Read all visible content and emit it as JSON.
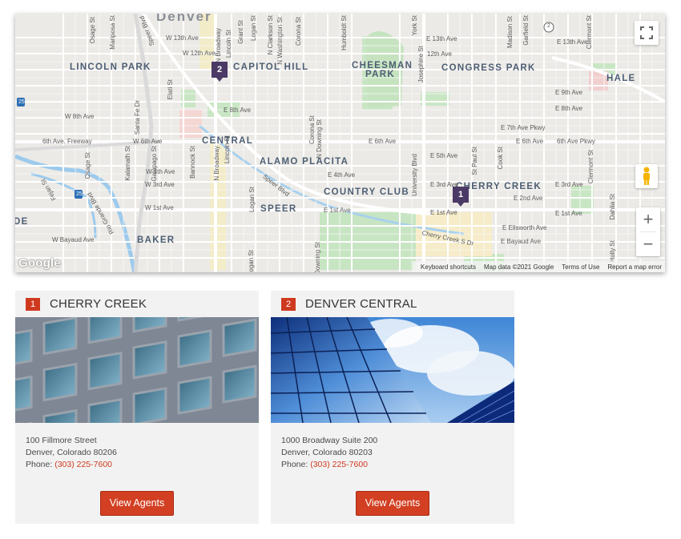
{
  "map": {
    "neighborhoods": [
      "Denver",
      "LINCOLN PARK",
      "CAPITOL HILL",
      "CHEESMAN",
      "PARK",
      "CONGRESS PARK",
      "HALE",
      "CENTRAL",
      "ALAMO PLACITA",
      "COUNTRY CLUB",
      "CHERRY CREEK",
      "SPEER",
      "BAKER",
      "DE"
    ],
    "streets": {
      "horizontal": [
        "W 13th Ave",
        "W 12th Ave",
        "E 13th Ave",
        "12th Ave",
        "E 13th Ave",
        "E 8th Ave",
        "E 9th Ave",
        "E 8th Ave",
        "W 8th Ave",
        "E 7th Ave Pkwy",
        "6th Ave. Freeway",
        "W 6th Ave",
        "E 6th Ave",
        "E 6th Ave",
        "6th Ave Pkwy",
        "E 5th Ave",
        "W 4th Ave",
        "E 4th Ave",
        "E 3rd Ave",
        "W 3rd Ave",
        "E 3rd Ave",
        "E 2nd Ave",
        "W 1st Ave",
        "E 1st Ave",
        "E 1st Ave",
        "E 1st Ave",
        "E Ellsworth Ave",
        "W Bayaud Ave",
        "E Bayaud Ave",
        "Speer Blvd",
        "Cherry Creek S Dr"
      ],
      "vertical": [
        "Osage St",
        "Mariposa St",
        "Speer Blvd",
        "N Broadway",
        "Lincoln St",
        "Grant St",
        "Logan St",
        "N Clarkson St",
        "N Washington St",
        "Corona St",
        "Humboldt St",
        "York St",
        "Josephine St",
        "Madison St",
        "Garfield St",
        "Clermont St",
        "Elati St",
        "Santa Fe Dr",
        "Osage St",
        "Kalamath St",
        "Galapago St",
        "Bannock St",
        "N Broadway",
        "Lincoln St",
        "Corona St",
        "N Downing St",
        "University Blvd",
        "St Paul St",
        "Cook St",
        "Clermont St",
        "Dahlia St",
        "Logan St",
        "Downing St",
        "S Logan St",
        "S Holly St",
        "Fejan St",
        "Rio Grande Blvd"
      ]
    },
    "markers": [
      {
        "label": "1"
      },
      {
        "label": "2"
      }
    ],
    "highway_shields": [
      "25",
      "25",
      "2"
    ],
    "controls": {
      "fullscreen_icon": "fullscreen-icon",
      "pegman_icon": "pegman-icon",
      "zoom_in": "+",
      "zoom_out": "−"
    },
    "google_logo": "Google",
    "attribution": {
      "shortcuts": "Keyboard shortcuts",
      "data": "Map data ©2021 Google",
      "terms": "Terms of Use",
      "report": "Report a map error"
    }
  },
  "offices": [
    {
      "number": "1",
      "name": "CHERRY CREEK",
      "address1": "100 Fillmore Street",
      "address2": "Denver, Colorado 80206",
      "phone_label": "Phone:",
      "phone": "(303) 225-7600",
      "button": "View Agents"
    },
    {
      "number": "2",
      "name": "DENVER CENTRAL",
      "address1": "1000 Broadway Suite 200",
      "address2": "Denver, Colorado 80203",
      "phone_label": "Phone:",
      "phone": "(303) 225-7600",
      "button": "View Agents"
    }
  ],
  "colors": {
    "accent": "#cf3a1f",
    "marker": "#4b3966",
    "label": "#4d5e74",
    "park": "#c7e6c2",
    "water": "#9ccaed"
  }
}
